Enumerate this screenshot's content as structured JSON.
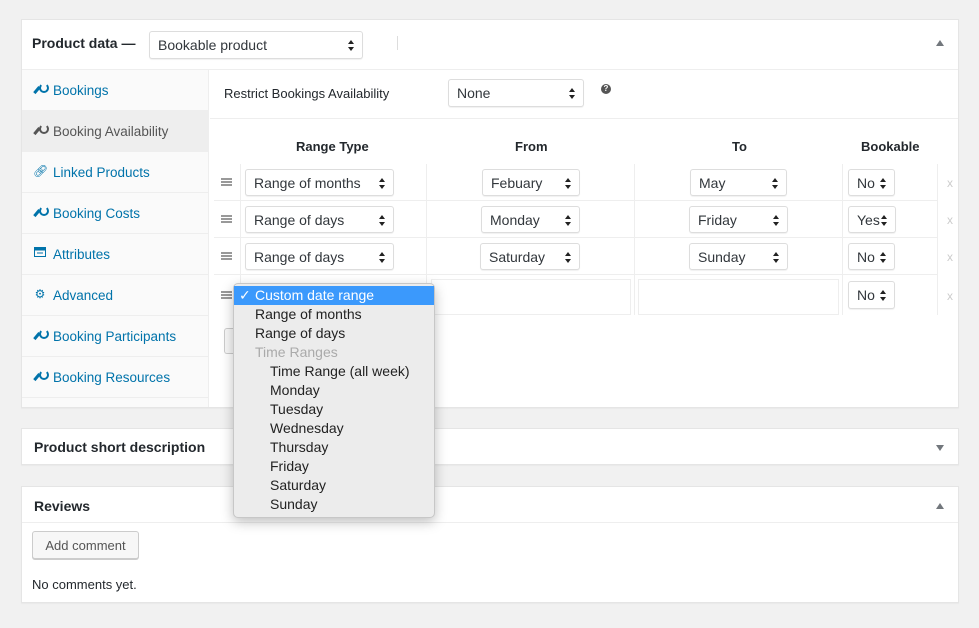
{
  "product_data": {
    "title": "Product data —",
    "type_select": "Bookable product",
    "tabs": [
      {
        "label": "Bookings",
        "icon": "wrench-icon"
      },
      {
        "label": "Booking Availability",
        "icon": "wrench-icon"
      },
      {
        "label": "Linked Products",
        "icon": "link-icon"
      },
      {
        "label": "Booking Costs",
        "icon": "wrench-icon"
      },
      {
        "label": "Attributes",
        "icon": "table-icon"
      },
      {
        "label": "Advanced",
        "icon": "gear-icon"
      },
      {
        "label": "Booking Participants",
        "icon": "wrench-icon"
      },
      {
        "label": "Booking Resources",
        "icon": "wrench-icon"
      }
    ],
    "active_tab": "Booking Availability",
    "restrict_label": "Restrict Bookings Availability",
    "restrict_value": "None",
    "help_icon": "?",
    "columns": [
      "Range Type",
      "From",
      "To",
      "Bookable"
    ],
    "rows": [
      {
        "range_type": "Range of months",
        "from": "Febuary",
        "to": "May",
        "bookable": "No",
        "delete": "x"
      },
      {
        "range_type": "Range of days",
        "from": "Monday",
        "to": "Friday",
        "bookable": "Yes",
        "delete": "x"
      },
      {
        "range_type": "Range of days",
        "from": "Saturday",
        "to": "Sunday",
        "bookable": "No",
        "delete": "x"
      },
      {
        "range_type": "Custom date range",
        "from": "",
        "to": "",
        "bookable": "No",
        "delete": "x"
      }
    ]
  },
  "dropdown": {
    "check_mark": "✓",
    "options": [
      {
        "label": "Custom date range",
        "selected": true
      },
      {
        "label": "Range of months"
      },
      {
        "label": "Range of days"
      },
      {
        "label": "Time Ranges",
        "group": true
      },
      {
        "label": "Time Range (all week)",
        "indent": true
      },
      {
        "label": "Monday",
        "indent": true
      },
      {
        "label": "Tuesday",
        "indent": true
      },
      {
        "label": "Wednesday",
        "indent": true
      },
      {
        "label": "Thursday",
        "indent": true
      },
      {
        "label": "Friday",
        "indent": true
      },
      {
        "label": "Saturday",
        "indent": true
      },
      {
        "label": "Sunday",
        "indent": true
      }
    ]
  },
  "short_description": {
    "title": "Product short description"
  },
  "reviews": {
    "title": "Reviews",
    "add_comment": "Add comment",
    "empty_text": "No comments yet."
  },
  "colors": {
    "link": "#0073aa",
    "highlight": "#3b99fc"
  }
}
